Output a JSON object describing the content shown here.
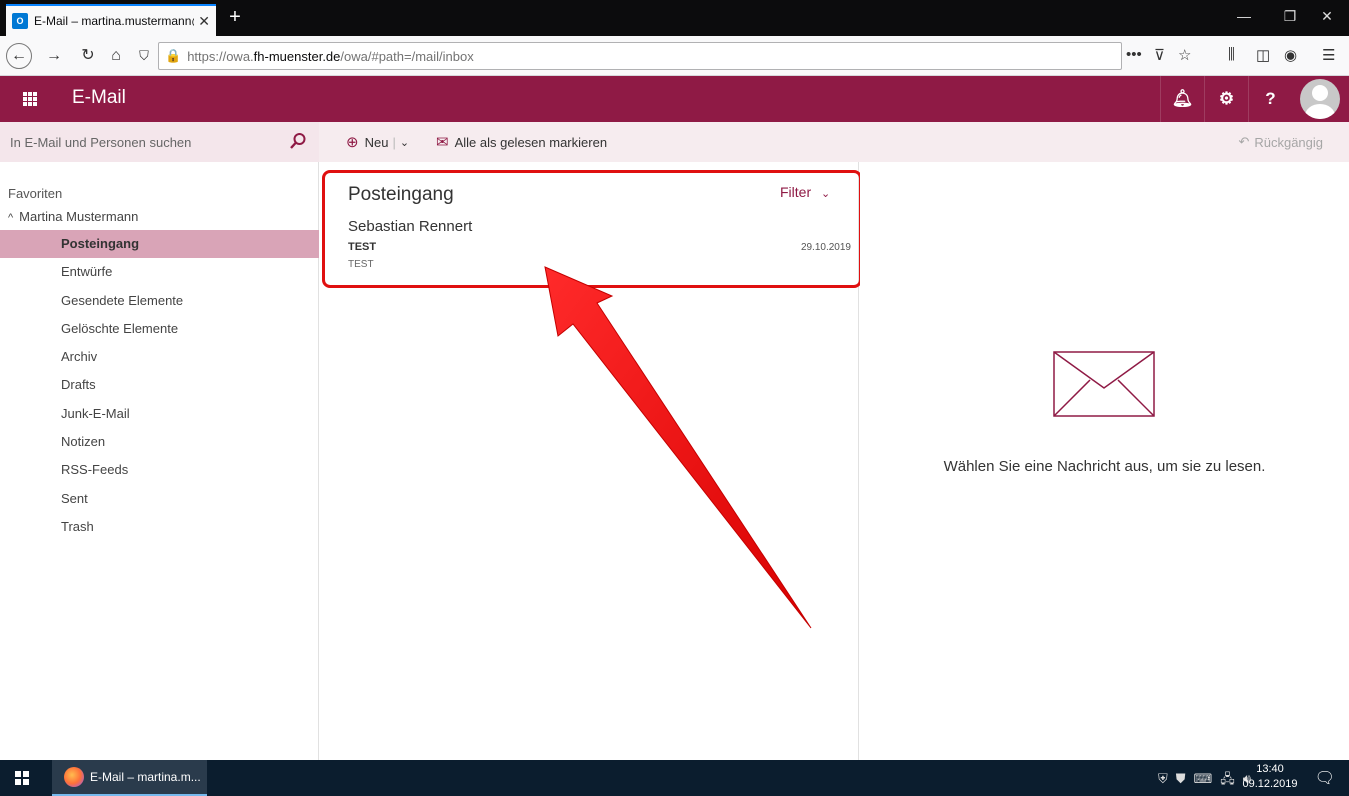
{
  "browser": {
    "tab_title": "E-Mail – martina.mustermann@",
    "tab_icon": "O",
    "new_tab": "+",
    "url_prefix": "https://owa.",
    "url_host": "fh-muenster.de",
    "url_path": "/owa/#path=/mail/inbox",
    "page_actions": "•••"
  },
  "header": {
    "app_title": "E-Mail",
    "brand_color": "#8f1a45"
  },
  "commands": {
    "search_placeholder": "In E-Mail und Personen suchen",
    "new_label": "Neu",
    "mark_all_read": "Alle als gelesen markieren",
    "undo": "Rückgängig"
  },
  "folders": {
    "favorites": "Favoriten",
    "account": "Martina Mustermann",
    "items": [
      {
        "label": "Posteingang",
        "selected": true
      },
      {
        "label": "Entwürfe"
      },
      {
        "label": "Gesendete Elemente"
      },
      {
        "label": "Gelöschte Elemente"
      },
      {
        "label": "Archiv"
      },
      {
        "label": "Drafts"
      },
      {
        "label": "Junk-E-Mail"
      },
      {
        "label": "Notizen"
      },
      {
        "label": "RSS-Feeds"
      },
      {
        "label": "Sent"
      },
      {
        "label": "Trash"
      }
    ]
  },
  "message_list": {
    "title": "Posteingang",
    "filter_label": "Filter",
    "messages": [
      {
        "sender": "Sebastian Rennert",
        "subject": "TEST",
        "date": "29.10.2019",
        "preview": "TEST"
      }
    ]
  },
  "reading_pane": {
    "empty_text": "Wählen Sie eine Nachricht aus, um sie zu lesen."
  },
  "taskbar": {
    "app_label": "E-Mail – martina.m...",
    "time": "13:40",
    "date": "09.12.2019"
  }
}
